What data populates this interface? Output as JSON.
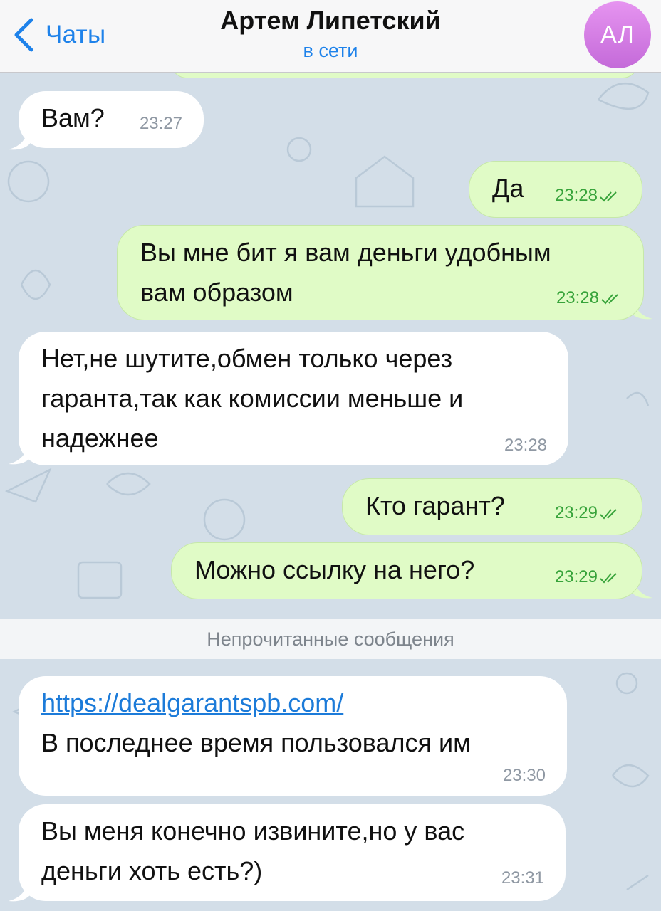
{
  "header": {
    "back_label": "Чаты",
    "contact_name": "Артем Липетский",
    "status": "в сети",
    "avatar_initials": "АЛ"
  },
  "messages": [
    {
      "direction": "in",
      "lines": [
        "Вам?"
      ],
      "time": "23:27"
    },
    {
      "direction": "out",
      "lines": [
        "Да"
      ],
      "time": "23:28",
      "read": true
    },
    {
      "direction": "out",
      "lines": [
        "Вы мне бит я вам деньги удобным",
        "вам образом"
      ],
      "time": "23:28",
      "read": true
    },
    {
      "direction": "in",
      "lines": [
        "Нет,не шутите,обмен только через",
        "гаранта,так как комиссии меньше и",
        "надежнее"
      ],
      "time": "23:28"
    },
    {
      "direction": "out",
      "lines": [
        "Кто гарант?"
      ],
      "time": "23:29",
      "read": true
    },
    {
      "direction": "out",
      "lines": [
        "Можно ссылку на него?"
      ],
      "time": "23:29",
      "read": true
    },
    {
      "direction": "in",
      "link": "https://dealgarantspb.com/",
      "lines": [
        "В последнее время пользовался им"
      ],
      "time": "23:30"
    },
    {
      "direction": "in",
      "lines": [
        "Вы меня конечно извините,но у вас",
        "деньги хоть есть?)"
      ],
      "time": "23:31"
    }
  ],
  "unread_divider": "Непрочитанные сообщения",
  "colors": {
    "accent": "#1e82ea",
    "incoming_bubble": "#ffffff",
    "outgoing_bubble": "#e0fbc6",
    "read_check": "#37a33a",
    "avatar": "#d27ee6"
  }
}
